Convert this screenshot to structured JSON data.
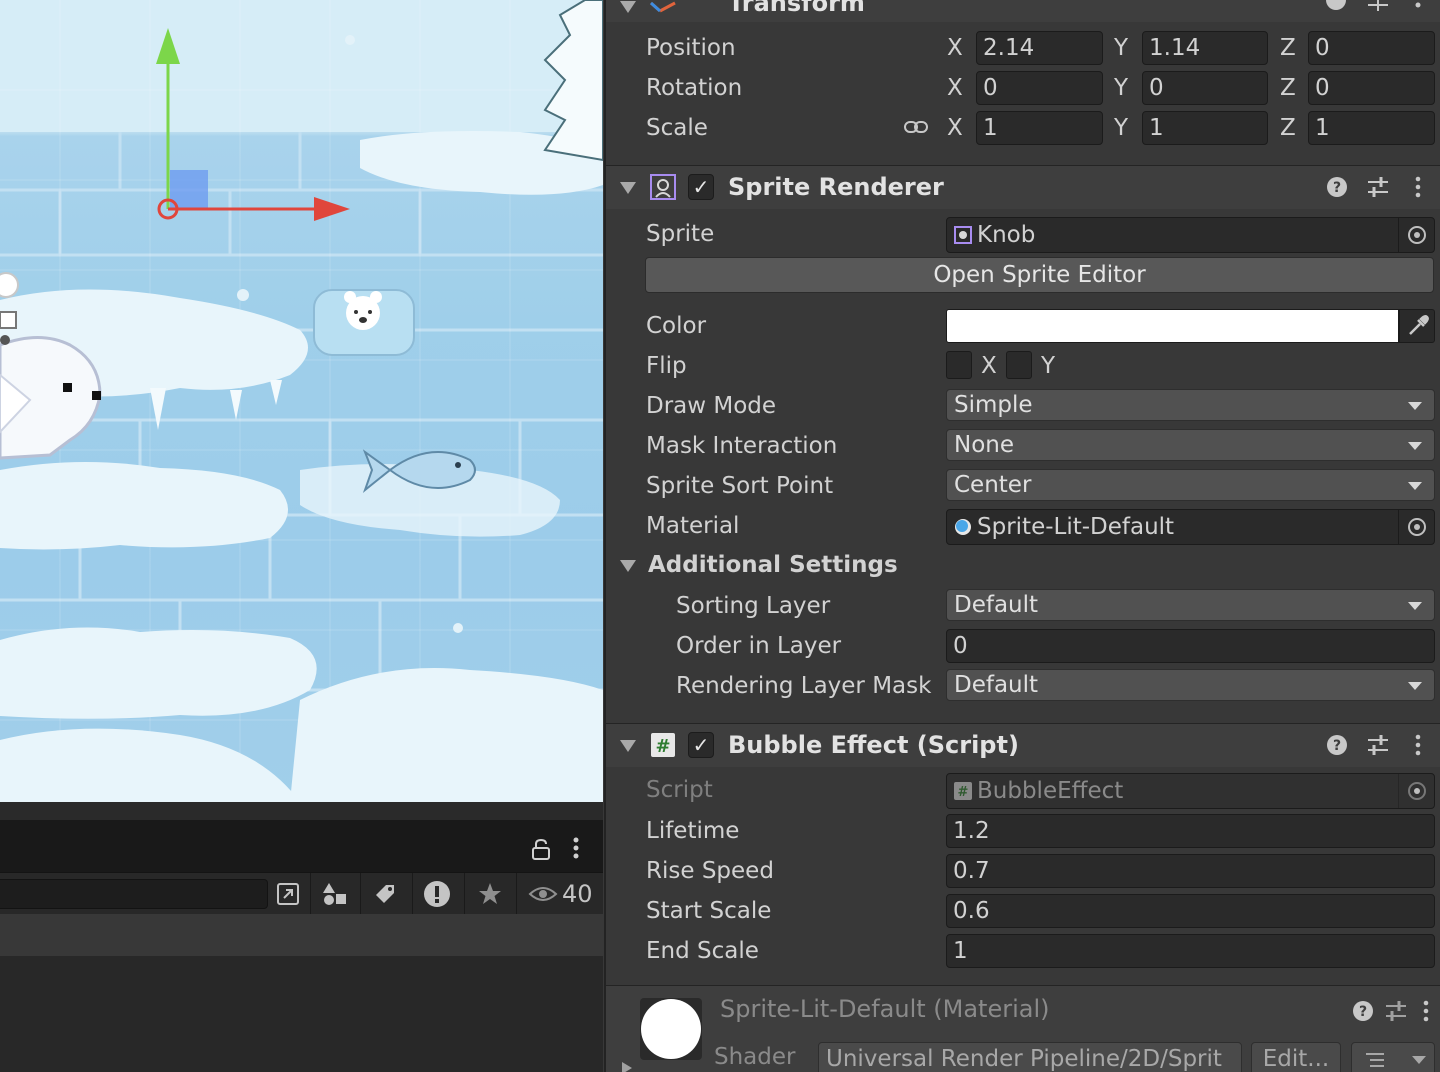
{
  "scene": {
    "gizmo": {
      "x_axis_color": "#e0463c",
      "y_axis_color": "#7cd64a",
      "plane_color": "#6e9cf0"
    },
    "background_color": "#9fcfea"
  },
  "hierarchy_panel": {
    "visible_count": "40",
    "icons": [
      "lock-icon",
      "kebab-menu-icon",
      "open-window-icon",
      "shapes-icon",
      "tag-icon",
      "warning-icon",
      "star-icon",
      "eye-icon"
    ]
  },
  "inspector": {
    "transform": {
      "title": "Transform",
      "position": {
        "label": "Position",
        "x": "2.14",
        "y": "1.14",
        "z": "0"
      },
      "rotation": {
        "label": "Rotation",
        "x": "0",
        "y": "0",
        "z": "0"
      },
      "scale": {
        "label": "Scale",
        "x": "1",
        "y": "1",
        "z": "1"
      },
      "axis_labels": {
        "x": "X",
        "y": "Y",
        "z": "Z"
      }
    },
    "sprite_renderer": {
      "title": "Sprite Renderer",
      "enabled": true,
      "sprite_label": "Sprite",
      "sprite_value": "Knob",
      "open_editor_label": "Open Sprite Editor",
      "color_label": "Color",
      "color_value": "#ffffff",
      "flip_label": "Flip",
      "flip_x": "X",
      "flip_y": "Y",
      "draw_mode_label": "Draw Mode",
      "draw_mode_value": "Simple",
      "mask_interaction_label": "Mask Interaction",
      "mask_interaction_value": "None",
      "sort_point_label": "Sprite Sort Point",
      "sort_point_value": "Center",
      "material_label": "Material",
      "material_value": "Sprite-Lit-Default",
      "additional_settings": {
        "title": "Additional Settings",
        "sorting_layer_label": "Sorting Layer",
        "sorting_layer_value": "Default",
        "order_label": "Order in Layer",
        "order_value": "0",
        "rendering_layer_label": "Rendering Layer Mask",
        "rendering_layer_value": "Default"
      }
    },
    "bubble_effect": {
      "title": "Bubble Effect (Script)",
      "enabled": true,
      "script_label": "Script",
      "script_value": "BubbleEffect",
      "lifetime_label": "Lifetime",
      "lifetime_value": "1.2",
      "rise_speed_label": "Rise Speed",
      "rise_speed_value": "0.7",
      "start_scale_label": "Start Scale",
      "start_scale_value": "0.6",
      "end_scale_label": "End Scale",
      "end_scale_value": "1"
    },
    "material_footer": {
      "title": "Sprite-Lit-Default (Material)",
      "shader_label": "Shader",
      "shader_value": "Universal Render Pipeline/2D/Sprit",
      "edit_label": "Edit..."
    }
  }
}
